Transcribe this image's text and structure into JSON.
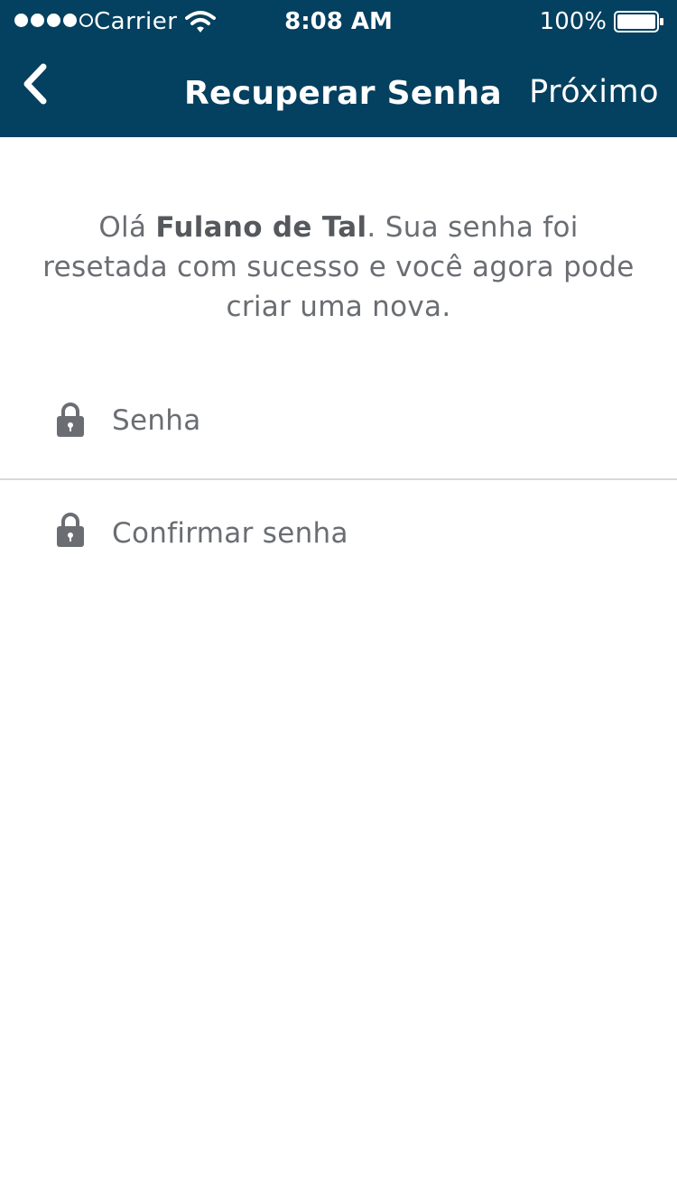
{
  "status_bar": {
    "carrier": "Carrier",
    "time": "8:08 AM",
    "battery": "100%",
    "signal_bars_filled": 4,
    "signal_bars_total": 5,
    "battery_level": 1.0
  },
  "nav": {
    "back_icon": "chevron-left-icon",
    "title": "Recuperar Senha",
    "next_label": "Próximo"
  },
  "message": {
    "prefix": "Olá ",
    "name": "Fulano de Tal",
    "suffix": ". Sua senha foi resetada com sucesso e você agora pode criar uma nova."
  },
  "form": {
    "password_placeholder": "Senha",
    "confirm_placeholder": "Confirmar senha",
    "field_icon": "lock-icon"
  },
  "colors": {
    "header_bg": "#04405f",
    "header_text": "#ffffff",
    "body_text": "#6a6d72",
    "icon": "#6a6d72",
    "divider": "#d9d9d9"
  }
}
